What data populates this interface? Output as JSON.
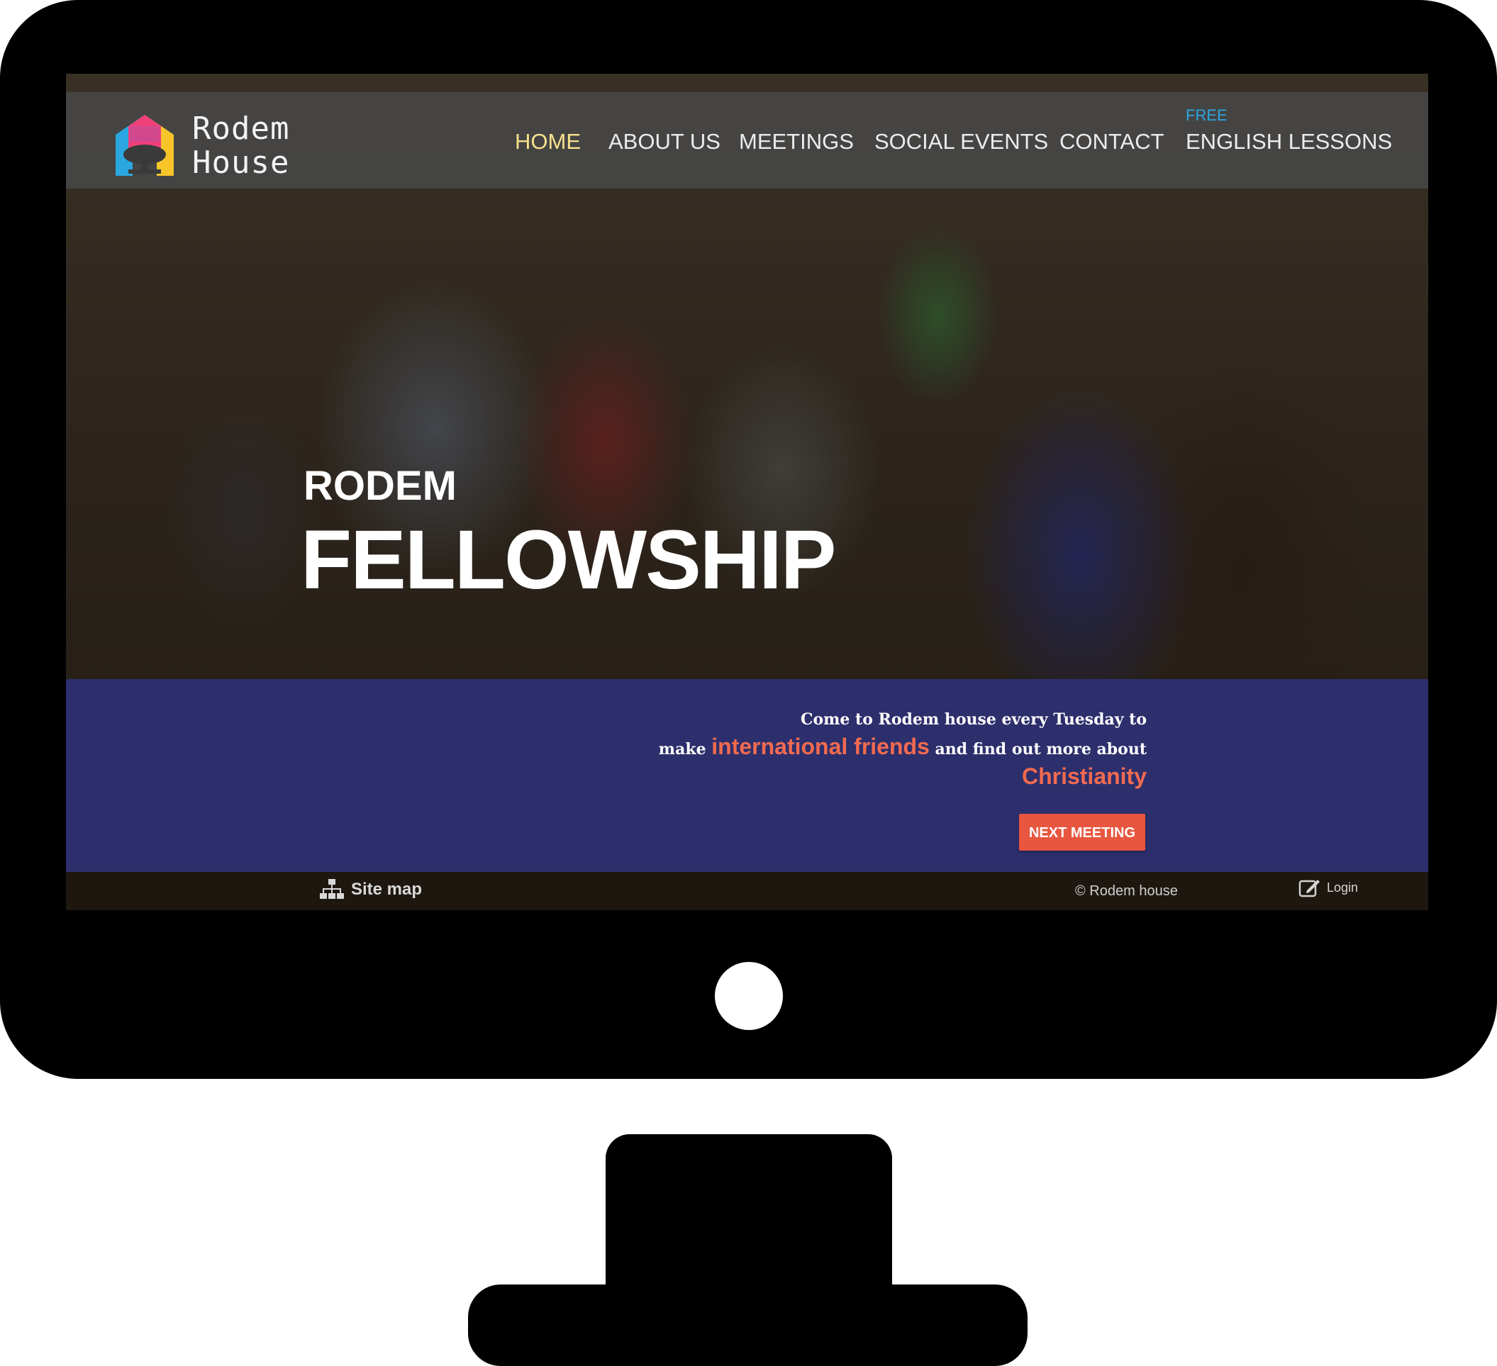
{
  "brand": {
    "line1": "Rodem",
    "line2": "House",
    "colors": {
      "pink": "#f0407a",
      "yellow": "#f7c52a",
      "blue": "#2aa7e0",
      "orange": "#f26a50"
    }
  },
  "nav": {
    "items": [
      {
        "label": "HOME",
        "active": true
      },
      {
        "label": "ABOUT US"
      },
      {
        "label": "MEETINGS"
      },
      {
        "label": "SOCIAL EVENTS"
      },
      {
        "label": "CONTACT"
      },
      {
        "label": "ENGLISH LESSONS",
        "badge": "FREE"
      }
    ],
    "active_color": "#f7e08c",
    "badge_color": "#2ca6e0"
  },
  "hero": {
    "subtitle": "RODEM",
    "title": "FELLOWSHIP"
  },
  "banner": {
    "line1": "Come to Rodem house every Tuesday to",
    "line2_prefix": "make",
    "line2_highlight": "international friends",
    "line2_suffix": "and find out more about",
    "line3_highlight": "Christianity",
    "button_label": "NEXT MEETING",
    "background": "#2e3073",
    "highlight_color": "#f26a50"
  },
  "footer": {
    "sitemap_label": "Site map",
    "sitemap_icon": "sitemap-icon",
    "copyright": "© Rodem house",
    "login_label": "Login",
    "login_icon": "edit-icon"
  }
}
